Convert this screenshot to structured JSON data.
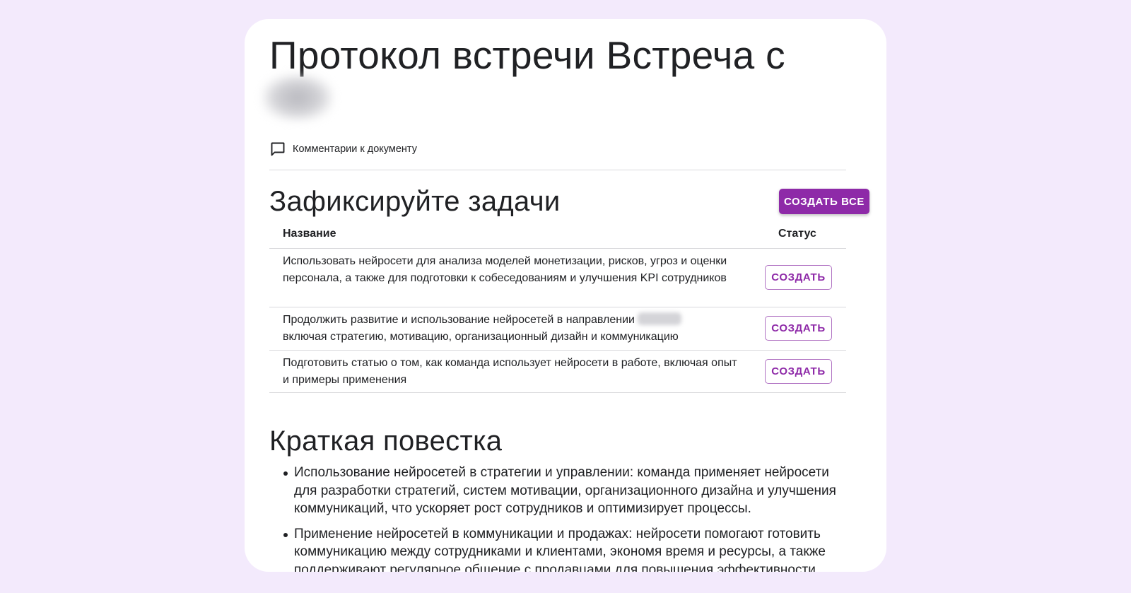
{
  "document": {
    "title": "Протокол встречи Встреча с",
    "comments_label": "Комментарии к документу"
  },
  "tasks": {
    "heading": "Зафиксируйте задачи",
    "create_all_label": "СОЗДАТЬ ВСЕ",
    "columns": {
      "name": "Название",
      "status": "Статус"
    },
    "rows": [
      {
        "text": "Использовать нейросети для анализа моделей монетизации, рисков, угроз и оценки персонала, а также для подготовки к собеседованиям и улучшения KPI сотрудников",
        "button": "СОЗДАТЬ"
      },
      {
        "text_before": "Продолжить развитие и использование нейросетей в направлении",
        "text_after": "включая стратегию, мотивацию, организационный дизайн и коммуникацию",
        "button": "СОЗДАТЬ"
      },
      {
        "text": "Подготовить статью о том, как команда использует нейросети в работе, включая опыт и примеры применения",
        "button": "СОЗДАТЬ"
      }
    ]
  },
  "agenda": {
    "heading": "Краткая повестка",
    "items": [
      "Использование нейросетей в стратегии и управлении: команда применяет нейросети для разработки стратегий, систем мотивации, организационного дизайна и улучшения коммуникаций, что ускоряет рост сотрудников и оптимизирует процессы.",
      "Применение нейросетей в коммуникации и продажах: нейросети помогают готовить коммуникацию между сотрудниками и клиентами, экономя время и ресурсы, а также поддерживают регулярное общение с продавцами для повышения эффективности."
    ]
  },
  "colors": {
    "accent": "#8e2aa8",
    "background": "#f3eafc",
    "card": "#ffffff"
  },
  "icons": {
    "comments": "comment-icon"
  }
}
